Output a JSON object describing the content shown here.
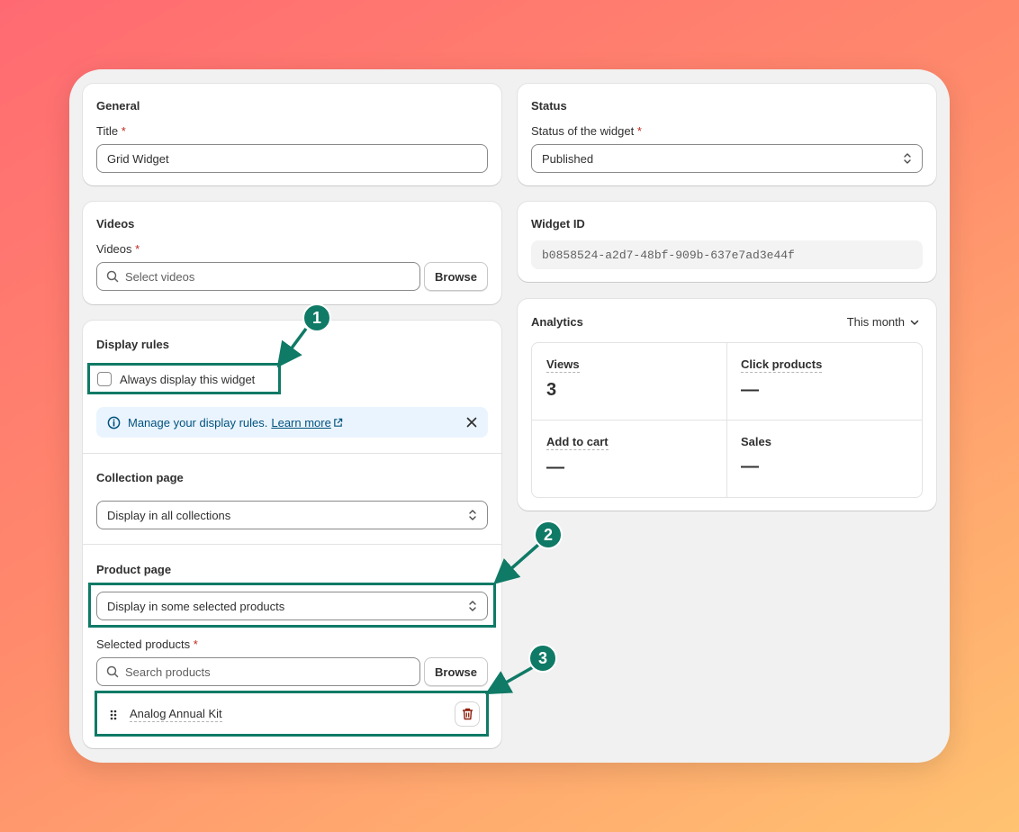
{
  "general": {
    "heading": "General",
    "title_label": "Title",
    "required_mark": "*",
    "title_value": "Grid Widget"
  },
  "videos": {
    "heading": "Videos",
    "label": "Videos",
    "placeholder": "Select videos",
    "browse": "Browse"
  },
  "display_rules": {
    "heading": "Display rules",
    "always_display": "Always display this widget",
    "always_display_checked": false,
    "banner_text": "Manage your display rules.",
    "banner_link": "Learn more"
  },
  "collection_page": {
    "heading": "Collection page",
    "selected": "Display in all collections"
  },
  "product_page": {
    "heading": "Product page",
    "selected": "Display in some selected products",
    "selected_products_label": "Selected products",
    "search_placeholder": "Search products",
    "browse": "Browse",
    "products": [
      "Analog Annual Kit"
    ]
  },
  "status": {
    "heading": "Status",
    "label": "Status of the widget",
    "selected": "Published"
  },
  "widget_id": {
    "heading": "Widget ID",
    "value": "b0858524-a2d7-48bf-909b-637e7ad3e44f"
  },
  "analytics": {
    "heading": "Analytics",
    "period": "This month",
    "metrics": [
      {
        "label": "Views",
        "value": "3"
      },
      {
        "label": "Click products",
        "value": "—"
      },
      {
        "label": "Add to cart",
        "value": "—"
      },
      {
        "label": "Sales",
        "value": "—"
      }
    ]
  },
  "annotations": [
    "1",
    "2",
    "3"
  ],
  "colors": {
    "accent": "#0f7a66",
    "required": "#c0271c",
    "banner_bg": "#eaf4ff",
    "banner_text": "#00527c",
    "delete_icon": "#8e1f0b"
  }
}
